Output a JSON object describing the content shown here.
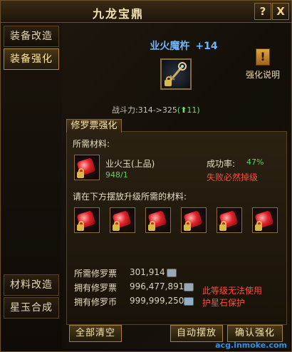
{
  "window": {
    "title": "九龙宝鼎",
    "help_button": "?",
    "close_button": "X"
  },
  "nav": {
    "items": [
      {
        "label": "装备改造"
      },
      {
        "label": "装备强化"
      },
      {
        "label": "材料改造"
      },
      {
        "label": "星玉合成"
      }
    ]
  },
  "item": {
    "name": "业火魔杵",
    "plus": "+14",
    "icon": "staff-item-icon"
  },
  "power": {
    "label": "战斗力:",
    "from_to": "314->325",
    "delta": "(⬆11)"
  },
  "help": {
    "icon": "exclamation-icon",
    "label": "强化说明"
  },
  "panel": {
    "tab_label": "修罗票强化",
    "required_materials_label": "所需材料:",
    "material": {
      "name": "业火玉(上品)",
      "count": "948/1"
    },
    "success_rate_label": "成功率:",
    "success_rate_value": "47%",
    "fail_note": "失败必然掉级",
    "place_prompt": "请在下方摆放升级所需的材料:",
    "gem_slots": 6
  },
  "resources": {
    "needed_label": "所需修罗票",
    "needed_value": "301,914",
    "owned_label": "拥有修罗票",
    "owned_value": "996,477,891",
    "coin_label": "拥有修罗币",
    "coin_value": "999,999,250",
    "protect_note_line1": "此等级无法使用",
    "protect_note_line2": "护星石保护"
  },
  "buttons": {
    "clear_all": "全部清空",
    "auto_place": "自动摆放",
    "confirm": "确认强化"
  },
  "watermark": "acg.inmoke.com",
  "colors": {
    "accent_gold": "#f3e3b0",
    "item_name_blue": "#6fb4ff",
    "success_green": "#5ed25e",
    "warning_red": "#ff4a38"
  }
}
